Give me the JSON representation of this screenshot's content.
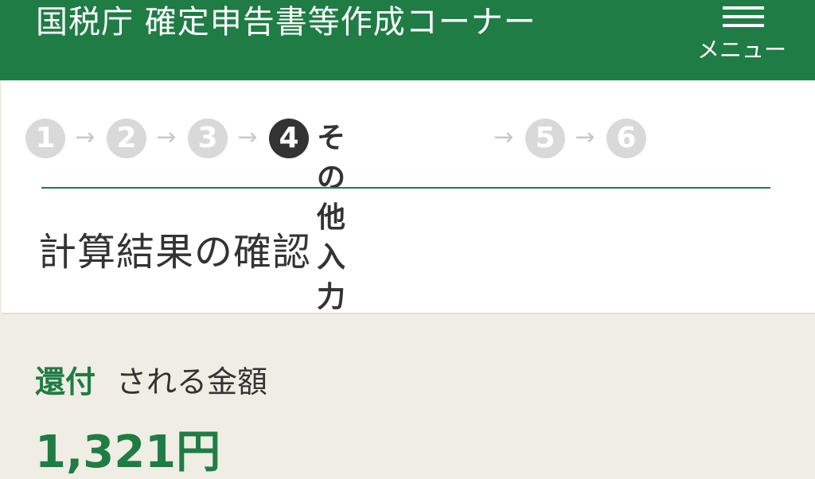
{
  "header": {
    "title": "国税庁 確定申告書等作成コーナー",
    "menu_label": "メニュー"
  },
  "steps": {
    "items": [
      "❶",
      "❷",
      "❸",
      "❹",
      "❺",
      "❻"
    ],
    "active_label": "その他入力",
    "arrow": "→"
  },
  "main": {
    "page_title": "計算結果の確認"
  },
  "refund": {
    "label_strong": "還付",
    "label_rest": "される金額",
    "amount": "1,321円"
  },
  "colors": {
    "brand_green": "#1f7c45",
    "inactive_step": "#d9d9d9",
    "active_step": "#333333",
    "panel_bg": "#f0ede4"
  }
}
